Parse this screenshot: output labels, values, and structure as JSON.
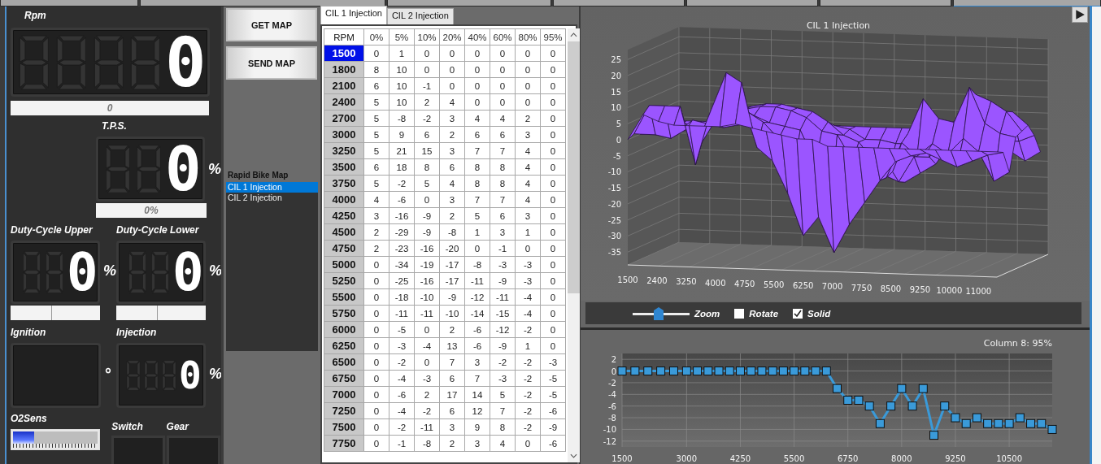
{
  "gauges": {
    "rpm": {
      "label": "Rpm",
      "value": "0",
      "readout": "0"
    },
    "tps": {
      "label": "T.P.S.",
      "value": "0",
      "unit": "%",
      "readout": "0%"
    },
    "duty_upper": {
      "label": "Duty-Cycle Upper",
      "value": "0",
      "unit": "%"
    },
    "duty_lower": {
      "label": "Duty-Cycle Lower",
      "value": "0",
      "unit": "%"
    },
    "ignition": {
      "label": "Ignition",
      "unit": "°"
    },
    "injection": {
      "label": "Injection",
      "value": "0",
      "unit": "%"
    },
    "o2sens": {
      "label": "O2Sens",
      "level": 0.25
    },
    "switch": {
      "label": "Switch"
    },
    "gear": {
      "label": "Gear"
    }
  },
  "map_buttons": [
    "GET MAP",
    "SEND MAP"
  ],
  "map_list": {
    "title": "Rapid Bike Map",
    "items": [
      {
        "label": "CIL 1 Injection",
        "selected": true
      },
      {
        "label": "CIL 2 Injection",
        "selected": false
      }
    ]
  },
  "table_tabs": [
    {
      "label": "CIL 1 Injection",
      "selected": true
    },
    {
      "label": "CIL 2 Injection",
      "selected": false
    }
  ],
  "table": {
    "columns": [
      "RPM",
      "0%",
      "5%",
      "10%",
      "20%",
      "40%",
      "60%",
      "80%",
      "95%"
    ],
    "rows": [
      {
        "rpm": "1500",
        "selected": true,
        "values": [
          "0",
          "1",
          "0",
          "0",
          "0",
          "0",
          "0",
          "0"
        ]
      },
      {
        "rpm": "1800",
        "selected": false,
        "values": [
          "8",
          "10",
          "0",
          "0",
          "0",
          "0",
          "0",
          "0"
        ]
      },
      {
        "rpm": "2100",
        "selected": false,
        "values": [
          "6",
          "10",
          "-1",
          "0",
          "0",
          "0",
          "0",
          "0"
        ]
      },
      {
        "rpm": "2400",
        "selected": false,
        "values": [
          "5",
          "10",
          "2",
          "4",
          "0",
          "0",
          "0",
          "0"
        ]
      },
      {
        "rpm": "2700",
        "selected": false,
        "values": [
          "5",
          "-8",
          "-2",
          "3",
          "4",
          "4",
          "2",
          "0"
        ]
      },
      {
        "rpm": "3000",
        "selected": false,
        "values": [
          "5",
          "9",
          "6",
          "2",
          "6",
          "6",
          "3",
          "0"
        ]
      },
      {
        "rpm": "3250",
        "selected": false,
        "values": [
          "5",
          "21",
          "15",
          "3",
          "7",
          "7",
          "4",
          "0"
        ]
      },
      {
        "rpm": "3500",
        "selected": false,
        "values": [
          "6",
          "18",
          "8",
          "6",
          "8",
          "8",
          "4",
          "0"
        ]
      },
      {
        "rpm": "3750",
        "selected": false,
        "values": [
          "5",
          "-2",
          "5",
          "4",
          "8",
          "8",
          "4",
          "0"
        ]
      },
      {
        "rpm": "4000",
        "selected": false,
        "values": [
          "4",
          "-6",
          "0",
          "3",
          "7",
          "7",
          "4",
          "0"
        ]
      },
      {
        "rpm": "4250",
        "selected": false,
        "values": [
          "3",
          "-16",
          "-9",
          "2",
          "5",
          "6",
          "3",
          "0"
        ]
      },
      {
        "rpm": "4500",
        "selected": false,
        "values": [
          "2",
          "-29",
          "-9",
          "-8",
          "1",
          "3",
          "1",
          "0"
        ]
      },
      {
        "rpm": "4750",
        "selected": false,
        "values": [
          "2",
          "-23",
          "-16",
          "-20",
          "0",
          "-1",
          "0",
          "0"
        ]
      },
      {
        "rpm": "5000",
        "selected": false,
        "values": [
          "0",
          "-34",
          "-19",
          "-17",
          "-8",
          "-3",
          "-3",
          "0"
        ]
      },
      {
        "rpm": "5250",
        "selected": false,
        "values": [
          "0",
          "-25",
          "-16",
          "-17",
          "-11",
          "-9",
          "-3",
          "0"
        ]
      },
      {
        "rpm": "5500",
        "selected": false,
        "values": [
          "0",
          "-18",
          "-10",
          "-9",
          "-12",
          "-11",
          "-4",
          "0"
        ]
      },
      {
        "rpm": "5750",
        "selected": false,
        "values": [
          "0",
          "-11",
          "-11",
          "-10",
          "-14",
          "-15",
          "-4",
          "0"
        ]
      },
      {
        "rpm": "6000",
        "selected": false,
        "values": [
          "0",
          "-5",
          "0",
          "2",
          "-6",
          "-12",
          "-2",
          "0"
        ]
      },
      {
        "rpm": "6250",
        "selected": false,
        "values": [
          "0",
          "-3",
          "-4",
          "13",
          "-6",
          "-9",
          "1",
          "0"
        ]
      },
      {
        "rpm": "6500",
        "selected": false,
        "values": [
          "0",
          "-2",
          "0",
          "7",
          "3",
          "-2",
          "-2",
          "-3"
        ]
      },
      {
        "rpm": "6750",
        "selected": false,
        "values": [
          "0",
          "-4",
          "-3",
          "6",
          "7",
          "-3",
          "-2",
          "-5"
        ]
      },
      {
        "rpm": "7000",
        "selected": false,
        "values": [
          "0",
          "-6",
          "2",
          "17",
          "14",
          "5",
          "-2",
          "-5"
        ]
      },
      {
        "rpm": "7250",
        "selected": false,
        "values": [
          "0",
          "-4",
          "-2",
          "6",
          "12",
          "7",
          "-2",
          "-6"
        ]
      },
      {
        "rpm": "7500",
        "selected": false,
        "values": [
          "0",
          "-2",
          "-11",
          "3",
          "9",
          "8",
          "-2",
          "-9"
        ]
      },
      {
        "rpm": "7750",
        "selected": false,
        "values": [
          "0",
          "-1",
          "-8",
          "2",
          "3",
          "4",
          "0",
          "-6"
        ]
      }
    ]
  },
  "surface_chart": {
    "title": "CIL 1 Injection",
    "z_ticks": [
      "25",
      "20",
      "15",
      "10",
      "5",
      "0",
      "-5",
      "-10",
      "-15",
      "-20",
      "-25",
      "-30",
      "-35"
    ],
    "x_ticks": [
      "1500",
      "2400",
      "3250",
      "4000",
      "4750",
      "5500",
      "6250",
      "7000",
      "7750",
      "8500",
      "9250",
      "10000",
      "11000"
    ]
  },
  "chart_toolbar": {
    "zoom": {
      "label": "Zoom",
      "level": 0.45
    },
    "options": [
      {
        "label": "Rotate",
        "checked": false
      },
      {
        "label": "Solid",
        "checked": true
      }
    ]
  },
  "column_chart": {
    "chart_data": {
      "type": "line",
      "title": "Column 8: 95%",
      "x": [
        1500,
        1800,
        2100,
        2400,
        2700,
        3000,
        3250,
        3500,
        3750,
        4000,
        4250,
        4500,
        4750,
        5000,
        5250,
        5500,
        5750,
        6000,
        6250,
        6500,
        6750,
        7000,
        7250,
        7500,
        7750,
        8000,
        8250,
        8500,
        8750,
        9000,
        9250,
        9500,
        9750,
        10000,
        10250,
        10500,
        10750,
        11000,
        11250,
        11500
      ],
      "grid": true,
      "series": [
        {
          "color": "#3a9ad9",
          "marker": "square",
          "values": [
            0,
            0,
            0,
            0,
            0,
            0,
            0,
            0,
            0,
            0,
            0,
            0,
            0,
            0,
            0,
            0,
            0,
            0,
            0,
            -3,
            -5,
            -5,
            -6,
            -9,
            -6,
            -3,
            -6,
            -3,
            -11,
            -6,
            -8,
            -9,
            -8,
            -9,
            -9,
            -9,
            -8,
            -9,
            -9,
            -10
          ]
        }
      ],
      "xlim": [
        1500,
        11500
      ],
      "ylim": [
        -13,
        3
      ],
      "yticks": [
        2,
        0,
        -2,
        -4,
        -6,
        -8,
        -10,
        -12
      ],
      "xticks": [
        1500,
        3000,
        4250,
        5500,
        6750,
        8000,
        9250,
        10500
      ]
    }
  }
}
